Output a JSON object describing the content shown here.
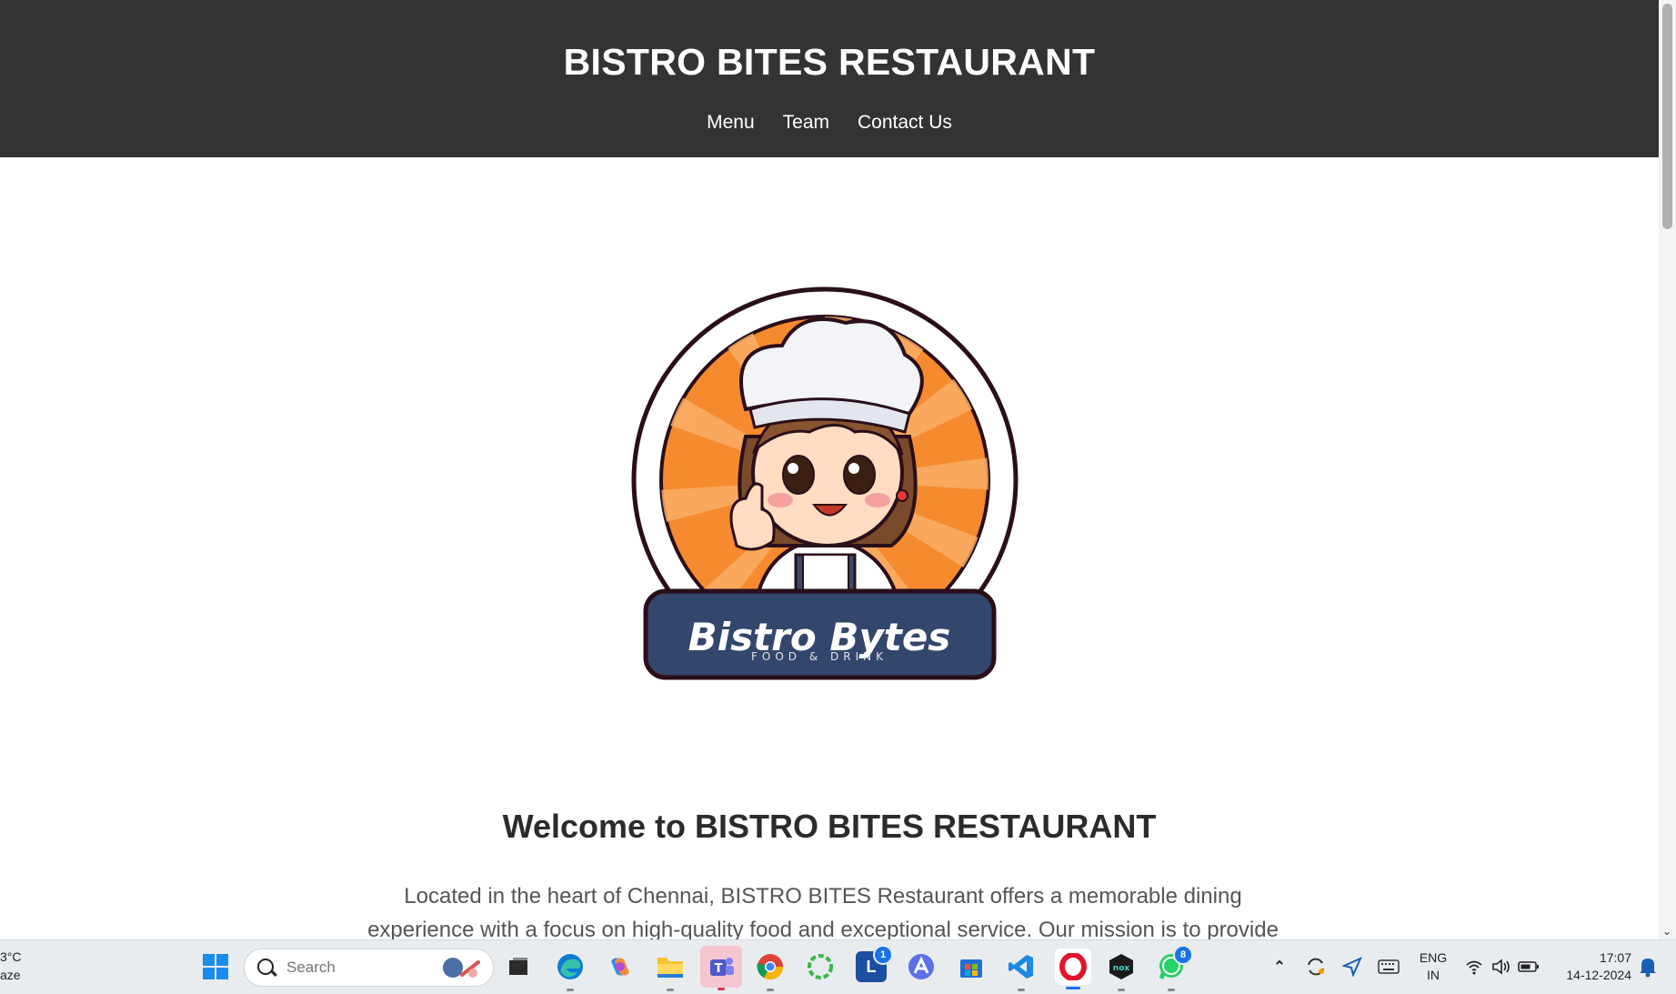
{
  "site": {
    "title": "BISTRO BITES RESTAURANT",
    "nav": [
      "Menu",
      "Team",
      "Contact Us"
    ]
  },
  "logo": {
    "name": "Bistro Bytes",
    "tagline": "FOOD & DRINK"
  },
  "content": {
    "welcome": "Welcome to BISTRO BITES RESTAURANT",
    "intro": "Located in the heart of Chennai, BISTRO BITES Restaurant offers a memorable dining experience with a focus on high-quality food and exceptional service. Our mission is to provide a wide variety of"
  },
  "taskbar": {
    "weather_temp": "3°C",
    "weather_desc": "aze",
    "search_placeholder": "Search",
    "apps": [
      {
        "name": "task-view-icon"
      },
      {
        "name": "edge-icon"
      },
      {
        "name": "copilot-icon"
      },
      {
        "name": "file-explorer-icon"
      },
      {
        "name": "teams-icon"
      },
      {
        "name": "chrome-icon"
      },
      {
        "name": "circle-app-icon"
      },
      {
        "name": "l-app-icon",
        "badge": "1"
      },
      {
        "name": "a-app-icon"
      },
      {
        "name": "store-icon"
      },
      {
        "name": "vscode-icon"
      },
      {
        "name": "opera-icon"
      },
      {
        "name": "nox-icon"
      },
      {
        "name": "whatsapp-icon",
        "badge": "8"
      }
    ],
    "language": "ENG",
    "region": "IN",
    "time": "17:07",
    "date": "14-12-2024"
  },
  "colors": {
    "header_bg": "#333333",
    "logo_orange": "#f58a2f",
    "logo_banner": "#33466b",
    "taskbar_bg": "#e9ecef"
  }
}
